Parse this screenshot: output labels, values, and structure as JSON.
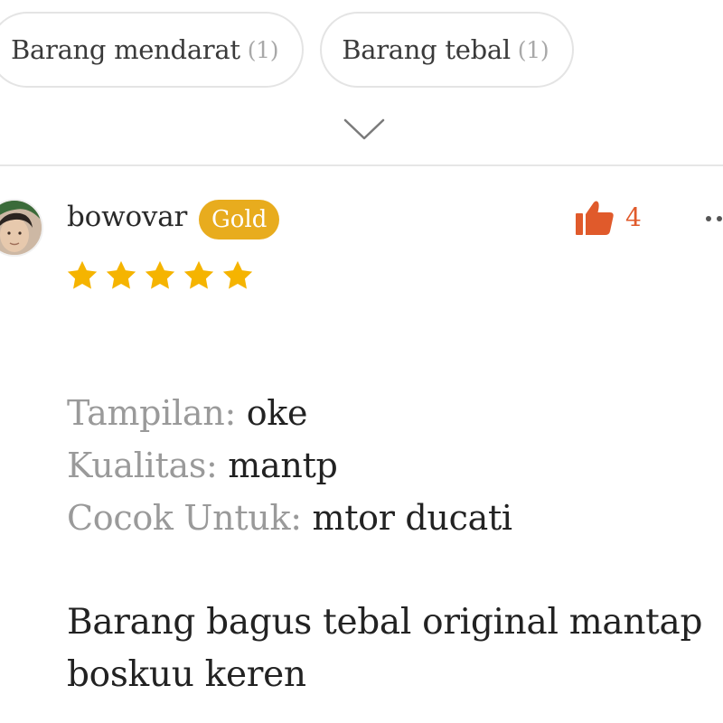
{
  "filters": [
    {
      "label": "Barang mendarat",
      "count": "(1)"
    },
    {
      "label": "Barang tebal",
      "count": "(1)"
    }
  ],
  "expand_icon": "chevron-down-icon",
  "review": {
    "username": "bowovar",
    "badge": "Gold",
    "badge_color": "#e8ac1e",
    "likes": "4",
    "like_color": "#e05a2b",
    "rating": 5,
    "rating_max": 5,
    "star_color": "#f5b400",
    "attributes": [
      {
        "label": "Tampilan:",
        "value": "oke"
      },
      {
        "label": "Kualitas:",
        "value": "mantp"
      },
      {
        "label": "Cocok Untuk:",
        "value": "mtor ducati"
      }
    ],
    "text": "Barang bagus tebal original mantap boskuu keren"
  }
}
